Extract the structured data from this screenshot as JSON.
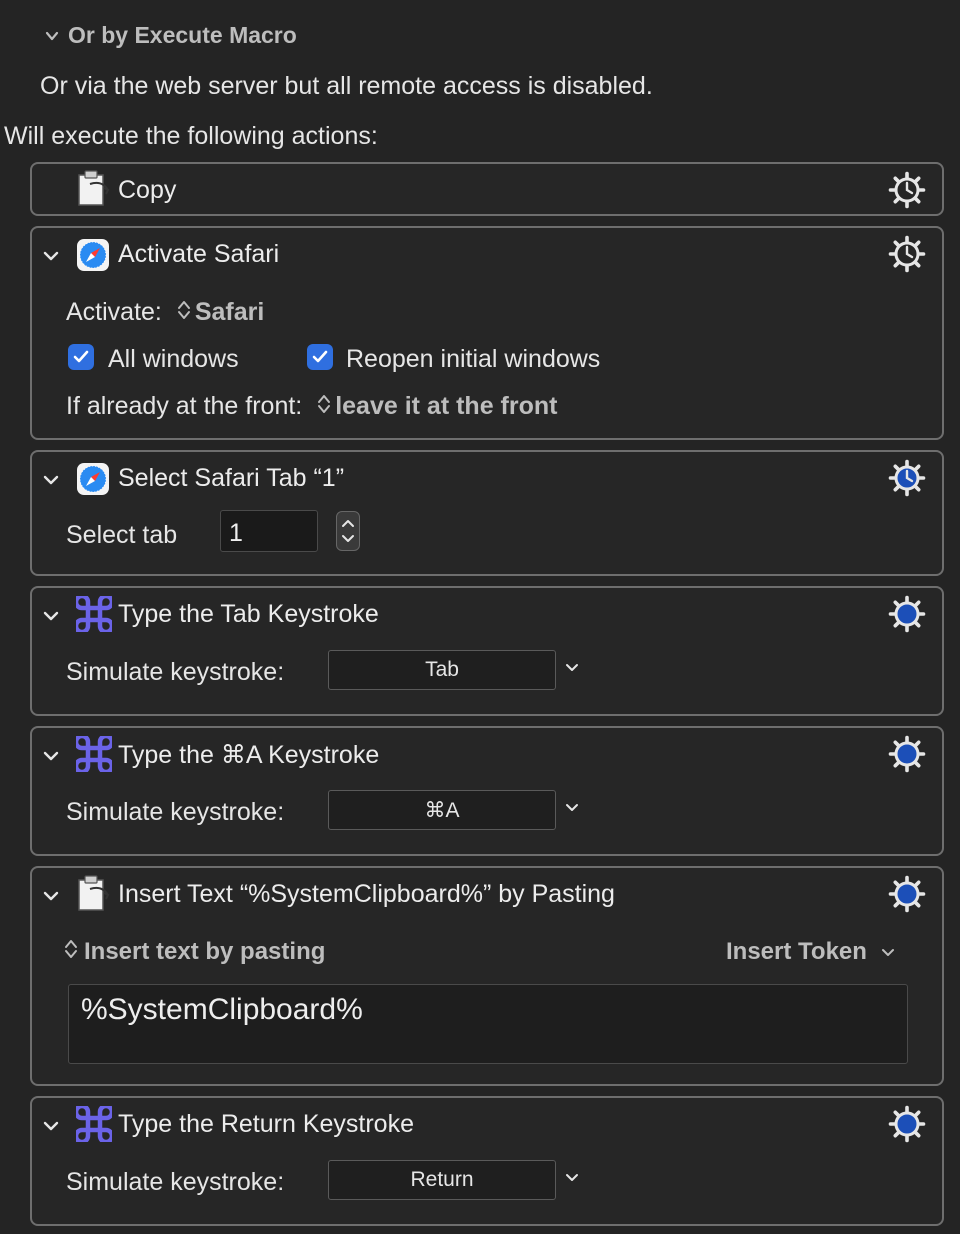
{
  "trigger": {
    "header": "Or by Execute Macro",
    "web_note": "Or via the web server but all remote access is disabled."
  },
  "actions_heading": "Will execute the following actions:",
  "actions": {
    "copy": {
      "title": "Copy"
    },
    "activate": {
      "title": "Activate Safari",
      "activate_label": "Activate:",
      "activate_value": "Safari",
      "all_windows_label": "All windows",
      "all_windows_checked": true,
      "reopen_label": "Reopen initial windows",
      "reopen_checked": true,
      "front_label": "If already at the front:",
      "front_value": "leave it at the front"
    },
    "select_tab": {
      "title": "Select Safari Tab “1”",
      "label": "Select tab",
      "value": "1"
    },
    "type_tab": {
      "title": "Type the Tab Keystroke",
      "label": "Simulate keystroke:",
      "key": "Tab"
    },
    "type_cmd_a": {
      "title": "Type the ⌘A Keystroke",
      "label": "Simulate keystroke:",
      "key": "⌘A"
    },
    "insert_text": {
      "title": "Insert Text “%SystemClipboard%” by Pasting",
      "mode": "Insert text by pasting",
      "token_label": "Insert Token",
      "text": "%SystemClipboard%"
    },
    "type_return": {
      "title": "Type the Return Keystroke",
      "label": "Simulate keystroke:",
      "key": "Return"
    }
  },
  "colors": {
    "background": "#242424",
    "card_border": "#6e6e6e",
    "accent_blue": "#2f6fe0",
    "command_icon": "#6b63e8"
  },
  "icons": {
    "copy": "clipboard-icon",
    "safari": "safari-compass-icon",
    "keystroke": "command-key-icon",
    "settings": "gear-icon",
    "disclosure": "chevron-down-icon"
  }
}
